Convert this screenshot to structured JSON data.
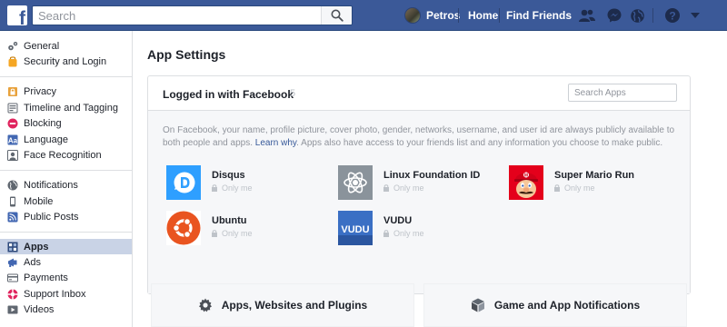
{
  "topbar": {
    "logo_letter": "f",
    "search_placeholder": "Search",
    "user_name": "Petros",
    "home_label": "Home",
    "find_friends_label": "Find Friends",
    "icons": [
      "friend-requests-icon",
      "messenger-icon",
      "notifications-globe-icon",
      "help-icon",
      "menu-caret-icon"
    ],
    "brand_color": "#3b5998"
  },
  "sidebar": {
    "groups": [
      [
        {
          "label": "General",
          "icon": "gears-icon"
        },
        {
          "label": "Security and Login",
          "icon": "shield-lock-icon"
        }
      ],
      [
        {
          "label": "Privacy",
          "icon": "lock-icon"
        },
        {
          "label": "Timeline and Tagging",
          "icon": "timeline-icon"
        },
        {
          "label": "Blocking",
          "icon": "block-icon"
        },
        {
          "label": "Language",
          "icon": "language-icon"
        },
        {
          "label": "Face Recognition",
          "icon": "face-icon"
        }
      ],
      [
        {
          "label": "Notifications",
          "icon": "globe-icon"
        },
        {
          "label": "Mobile",
          "icon": "mobile-icon"
        },
        {
          "label": "Public Posts",
          "icon": "rss-icon"
        }
      ],
      [
        {
          "label": "Apps",
          "icon": "apps-icon",
          "active": true
        },
        {
          "label": "Ads",
          "icon": "ads-icon"
        },
        {
          "label": "Payments",
          "icon": "payments-icon"
        },
        {
          "label": "Support Inbox",
          "icon": "support-icon"
        },
        {
          "label": "Videos",
          "icon": "video-icon"
        }
      ]
    ]
  },
  "main": {
    "title": "App Settings",
    "card": {
      "title": "Logged in with Facebook",
      "count": "5",
      "search_placeholder": "Search Apps",
      "notice_pre": "On Facebook, your name, profile picture, cover photo, gender, networks, username, and user id are always publicly available to both people and apps. ",
      "notice_link": "Learn why",
      "notice_post": ". Apps also have access to your friends list and any information you choose to make public.",
      "apps": [
        {
          "name": "Disqus",
          "privacy": "Only me",
          "icon": "disqus-logo",
          "color": "#2e9fff"
        },
        {
          "name": "Linux Foundation ID",
          "privacy": "Only me",
          "icon": "linux-foundation-logo",
          "color": "#8a939b"
        },
        {
          "name": "Super Mario Run",
          "privacy": "Only me",
          "icon": "mario-logo",
          "color": "#e4001b"
        },
        {
          "name": "Ubuntu",
          "privacy": "Only me",
          "icon": "ubuntu-logo",
          "color": "#e95420"
        },
        {
          "name": "VUDU",
          "privacy": "Only me",
          "icon": "vudu-logo",
          "color": "#3a6fc4"
        }
      ]
    },
    "sections": [
      {
        "label": "Apps, Websites and Plugins",
        "icon": "gear-icon"
      },
      {
        "label": "Game and App Notifications",
        "icon": "cube-icon"
      }
    ]
  }
}
